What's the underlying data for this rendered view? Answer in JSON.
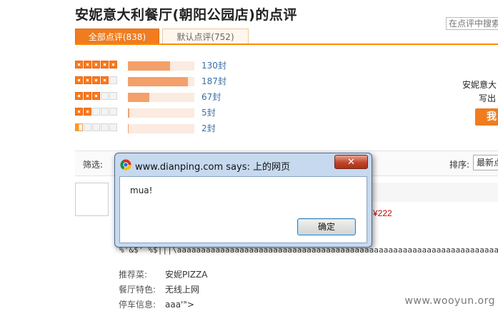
{
  "header": {
    "title": "安妮意大利餐厅(朝阳公园店)的点评",
    "search_placeholder": "在点评中搜索"
  },
  "tabs": [
    {
      "label": "全部点评(838)",
      "active": true
    },
    {
      "label": "默认点评(752)",
      "active": false
    }
  ],
  "ratings": [
    {
      "stars": 5,
      "count_text": "130封",
      "share": 0.33
    },
    {
      "stars": 4,
      "count_text": "187封",
      "share": 0.47
    },
    {
      "stars": 3,
      "count_text": "67封",
      "share": 0.17
    },
    {
      "stars": 2,
      "count_text": "5封",
      "share": 0.01
    },
    {
      "stars": 1,
      "count_text": "2封",
      "share": 0.005
    }
  ],
  "side_panel": {
    "line1": "安妮意大",
    "line2": "写出",
    "button": "我"
  },
  "filter": {
    "label": "筛选:",
    "sort_label": "排序:",
    "sort_value": "最新点"
  },
  "review": {
    "price": "¥222",
    "text": "%'&$' %$|||\\aaaaaaaaaaaaaaaaaaaaaaaaaaaaaaaaaaaaaaaaaaaaaaaaaaaaaaaaaaaaaaaaaaa",
    "info": [
      {
        "label": "推荐菜:",
        "value": "安妮PIZZA"
      },
      {
        "label": "餐厅特色:",
        "value": "无线上网"
      },
      {
        "label": "停车信息:",
        "value": "aaa'\">"
      }
    ]
  },
  "dialog": {
    "title": "www.dianping.com says: 上的网页",
    "message": "mua!",
    "ok_label": "确定",
    "close_label": "✕"
  },
  "watermark": "www.wooyun.org",
  "colors": {
    "accent": "#f07c1e",
    "star_on": "#ff7b1a",
    "bar_fill": "#f4a06a",
    "bar_track": "#fbebe0",
    "link": "#3a6ea5",
    "price": "#cc0000",
    "dialog_frame": "#c6d9ee"
  }
}
